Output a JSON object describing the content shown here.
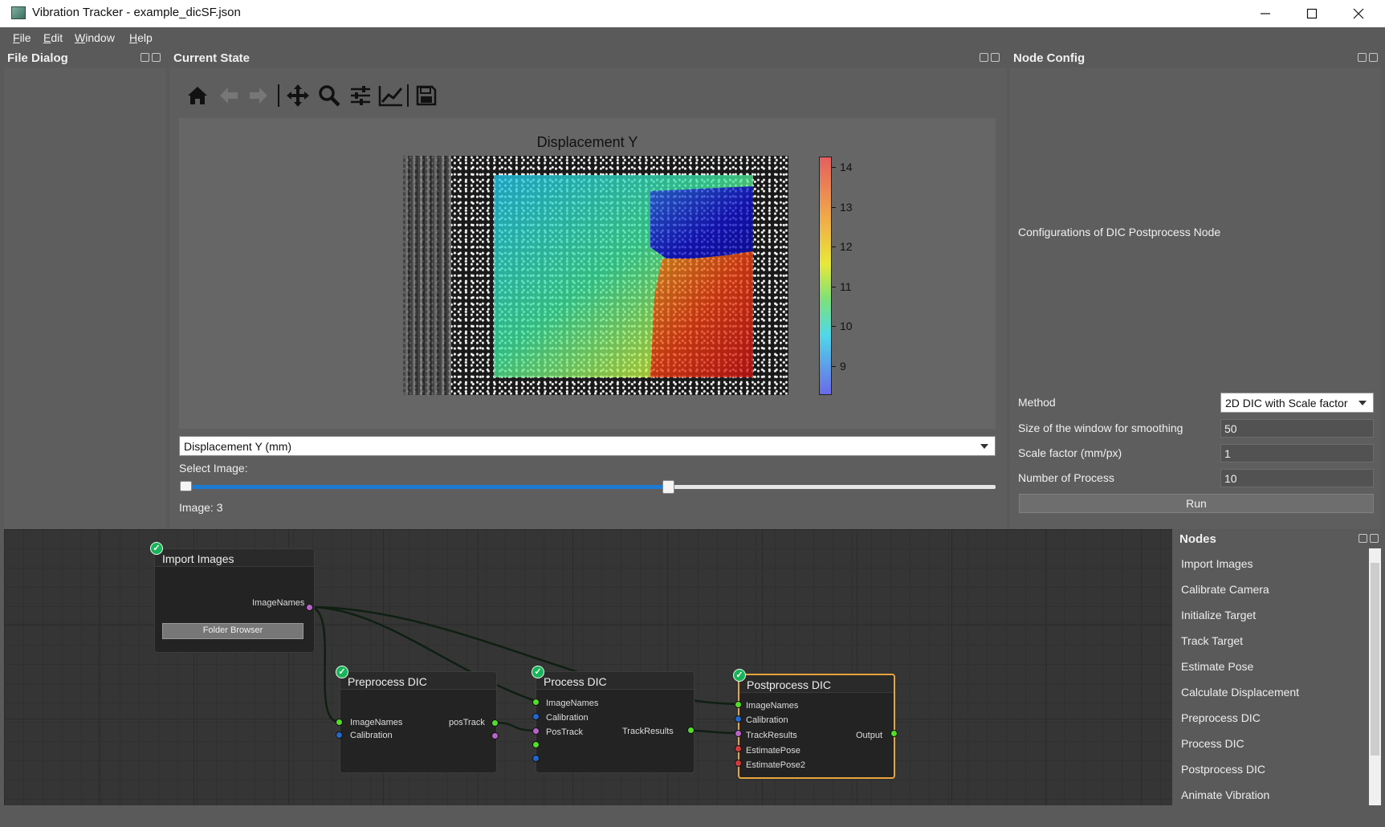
{
  "window": {
    "title": "Vibration Tracker - example_dicSF.json"
  },
  "menu": [
    "File",
    "Edit",
    "Window",
    "Help"
  ],
  "docks": {
    "file_dialog": "File Dialog",
    "current_state": "Current State",
    "node_config": "Node Config",
    "nodes": "Nodes"
  },
  "toolbar": [
    "home-icon",
    "back-arrow-icon",
    "forward-arrow-icon",
    "pan-icon",
    "zoom-icon",
    "configure-subplots-icon",
    "edit-axis-icon",
    "save-icon"
  ],
  "figure": {
    "title": "Displacement Y",
    "colorbar_ticks": [
      "14",
      "13",
      "12",
      "11",
      "10",
      "9"
    ],
    "colorbar_range": [
      8.6,
      14.6
    ],
    "colormap": "rainbow"
  },
  "display_select": {
    "value": "Displacement Y (mm)"
  },
  "image_slider": {
    "label": "Select Image:",
    "value_fraction": 0.6,
    "image_text": "Image: 3"
  },
  "node_config": {
    "description": "Configurations of DIC Postprocess Node",
    "method_label": "Method",
    "method_value": "2D DIC with Scale factor",
    "smooth_label": "Size of the window for smoothing",
    "smooth_value": "50",
    "scale_label": "Scale factor (mm/px)",
    "scale_value": "1",
    "process_label": "Number of Process",
    "process_value": "10",
    "run_label": "Run"
  },
  "graph": {
    "import_images": {
      "title": "Import Images",
      "out": "ImageNames",
      "button": "Folder Browser"
    },
    "preprocess_dic": {
      "title": "Preprocess DIC",
      "in1": "ImageNames",
      "in2": "Calibration",
      "out1": "posTrack"
    },
    "process_dic": {
      "title": "Process DIC",
      "in1": "ImageNames",
      "in2": "Calibration",
      "in3": "PosTrack",
      "out1": "TrackResults"
    },
    "postprocess_dic": {
      "title": "Postprocess DIC",
      "in1": "ImageNames",
      "in2": "Calibration",
      "in3": "TrackResults",
      "in4": "EstimatePose",
      "in5": "EstimatePose2",
      "out1": "Output"
    }
  },
  "nodes_list": [
    "Import Images",
    "Calibrate Camera",
    "Initialize Target",
    "Track Target",
    "Estimate Pose",
    "Calculate Displacement",
    "Preprocess DIC",
    "Process DIC",
    "Postprocess DIC",
    "Animate Vibration"
  ]
}
